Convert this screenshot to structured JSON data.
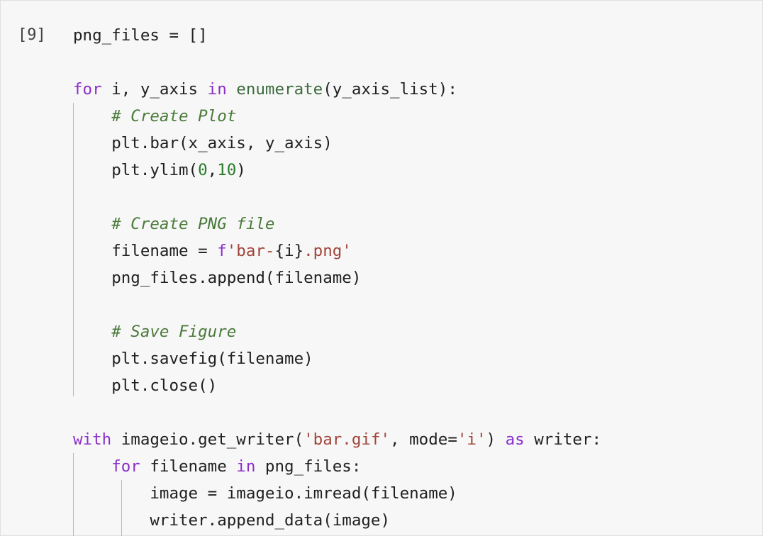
{
  "cell": {
    "prompt": "[9]",
    "lines": [
      {
        "indent": 0,
        "tokens": [
          {
            "t": "png_files = []",
            "c": ""
          }
        ]
      },
      {
        "indent": 0,
        "tokens": [
          {
            "t": "",
            "c": ""
          }
        ]
      },
      {
        "indent": 0,
        "tokens": [
          {
            "t": "for",
            "c": "kw"
          },
          {
            "t": " i, y_axis ",
            "c": ""
          },
          {
            "t": "in",
            "c": "kw"
          },
          {
            "t": " ",
            "c": ""
          },
          {
            "t": "enumerate",
            "c": "fn"
          },
          {
            "t": "(y_axis_list):",
            "c": ""
          }
        ]
      },
      {
        "indent": 1,
        "tokens": [
          {
            "t": "# Create Plot",
            "c": "cm"
          }
        ]
      },
      {
        "indent": 1,
        "tokens": [
          {
            "t": "plt.bar(x_axis, y_axis)",
            "c": ""
          }
        ]
      },
      {
        "indent": 1,
        "tokens": [
          {
            "t": "plt.ylim(",
            "c": ""
          },
          {
            "t": "0",
            "c": "num"
          },
          {
            "t": ",",
            "c": ""
          },
          {
            "t": "10",
            "c": "num"
          },
          {
            "t": ")",
            "c": ""
          }
        ]
      },
      {
        "indent": 0,
        "tokens": [
          {
            "t": "",
            "c": ""
          }
        ]
      },
      {
        "indent": 1,
        "tokens": [
          {
            "t": "# Create PNG file",
            "c": "cm"
          }
        ]
      },
      {
        "indent": 1,
        "tokens": [
          {
            "t": "filename = ",
            "c": ""
          },
          {
            "t": "f",
            "c": "kw"
          },
          {
            "t": "'bar-",
            "c": "str"
          },
          {
            "t": "{i}",
            "c": ""
          },
          {
            "t": ".png'",
            "c": "str"
          }
        ]
      },
      {
        "indent": 1,
        "tokens": [
          {
            "t": "png_files.append(filename)",
            "c": ""
          }
        ]
      },
      {
        "indent": 0,
        "tokens": [
          {
            "t": "",
            "c": ""
          }
        ]
      },
      {
        "indent": 1,
        "tokens": [
          {
            "t": "# Save Figure",
            "c": "cm"
          }
        ]
      },
      {
        "indent": 1,
        "tokens": [
          {
            "t": "plt.savefig(filename)",
            "c": ""
          }
        ]
      },
      {
        "indent": 1,
        "tokens": [
          {
            "t": "plt.close()",
            "c": ""
          }
        ]
      },
      {
        "indent": 0,
        "tokens": [
          {
            "t": "",
            "c": ""
          }
        ]
      },
      {
        "indent": 0,
        "tokens": [
          {
            "t": "with",
            "c": "kw"
          },
          {
            "t": " imageio.get_writer(",
            "c": ""
          },
          {
            "t": "'bar.gif'",
            "c": "str"
          },
          {
            "t": ", mode=",
            "c": ""
          },
          {
            "t": "'i'",
            "c": "str"
          },
          {
            "t": ") ",
            "c": ""
          },
          {
            "t": "as",
            "c": "kw"
          },
          {
            "t": " writer:",
            "c": ""
          }
        ]
      },
      {
        "indent": 1,
        "tokens": [
          {
            "t": "for",
            "c": "kw"
          },
          {
            "t": " filename ",
            "c": ""
          },
          {
            "t": "in",
            "c": "kw"
          },
          {
            "t": " png_files:",
            "c": ""
          }
        ]
      },
      {
        "indent": 2,
        "tokens": [
          {
            "t": "image = imageio.imread(filename)",
            "c": ""
          }
        ]
      },
      {
        "indent": 2,
        "tokens": [
          {
            "t": "writer.append_data(image)",
            "c": ""
          }
        ]
      }
    ]
  },
  "colors": {
    "background": "#f7f7f7",
    "keyword": "#8b2fc9",
    "builtin": "#3d6b3d",
    "number": "#2a7a2a",
    "string": "#a0453a",
    "comment": "#4a7a3a"
  }
}
